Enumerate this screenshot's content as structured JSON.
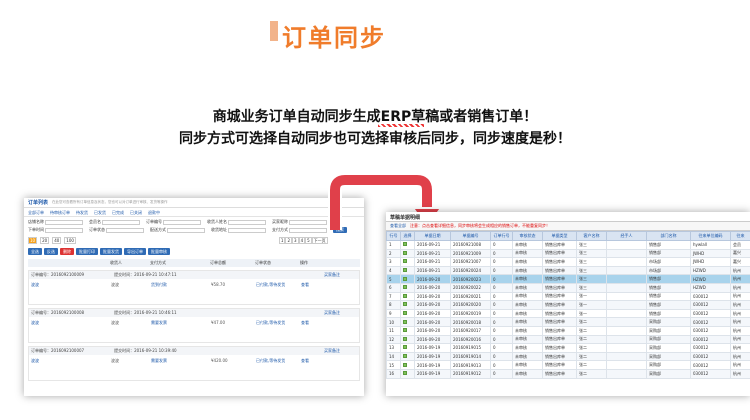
{
  "slide": {
    "title": "订单同步",
    "headline1": "商城业务订单自动同步生成ERP草稿或者销售订单！",
    "headline2": "同步方式可选择自动同步也可选择审核后同步，同步速度是秒！"
  },
  "colors": {
    "title": "#f07c2b",
    "arrow": "#e0404a",
    "grid_header": "#d9e4f2",
    "selected_row": "#a8d3ec"
  },
  "left_panel": {
    "title": "订单列表",
    "subtitle": "在此您可查看所有订单信息及状态，您也可以对订单进行审核、发货等操作",
    "tabs": [
      "全部订单",
      "待审核订单",
      "待发货",
      "已发货",
      "已完成",
      "已关闭",
      "退款中"
    ],
    "filters": [
      "店铺名称",
      "会员名",
      "订单编号",
      "收货人姓名",
      "买家昵称",
      "下单时间",
      "订单状态",
      "配送方式",
      "收货地址",
      "支付方式"
    ],
    "search_label": "搜索",
    "pager": [
      "10",
      "20",
      "40",
      "100"
    ],
    "pager_nav": [
      "1",
      "2",
      "3",
      "4",
      "5",
      "下一页"
    ],
    "actions": [
      "全选",
      "反选",
      "删除",
      "批量打印",
      "批量发货",
      "导出订单",
      "批量审核"
    ],
    "columns": [
      "收货人",
      "支付方式",
      "订单总额",
      "订单状态",
      "操作"
    ],
    "orders": [
      {
        "no": "订单编号：2016092100009",
        "time": "提交时间：2016-09-21 10:47:11",
        "buyer": "波波",
        "pay": "货到付款",
        "amount": "¥58.70",
        "status": "已付款,等待发货",
        "link": "查看",
        "shop": "买家备注"
      },
      {
        "no": "订单编号：2016092100008",
        "time": "提交时间：2016-09-21 10:46:11",
        "buyer": "波波",
        "pay": "需要发票",
        "amount": "¥47.00",
        "status": "已付款,等待发货",
        "link": "查看",
        "shop": "买家备注"
      },
      {
        "no": "订单编号：2016092100007",
        "time": "提交时间：2016-09-21 10:39:40",
        "buyer": "波波",
        "pay": "需要发票",
        "amount": "¥420.00",
        "status": "已付款,等待发货",
        "link": "查看",
        "shop": "买家备注"
      }
    ]
  },
  "right_panel": {
    "title": "草稿单据明细",
    "toolbar": [
      "查看全部",
      "注意：点击查看详细信息，同步审核将会生成相应的销售订单，不能重复同步！"
    ],
    "columns": [
      "行号",
      "选择",
      "单据日期",
      "单据编号",
      "订单行号",
      "审核状态",
      "单据类型",
      "客户名称",
      "经手人",
      "部门名称",
      "往来单位编码",
      "往来"
    ],
    "rows": [
      [
        "1",
        "2016-09-21",
        "20160921008",
        "0",
        "未审核",
        "销售出库单",
        "张三",
        "销售部",
        "hywlall",
        "会员"
      ],
      [
        "2",
        "2016-09-21",
        "20160921009",
        "0",
        "未审核",
        "销售出库单",
        "张三",
        "销售部",
        "JWHD",
        "嘉兴"
      ],
      [
        "3",
        "2016-09-21",
        "20160921007",
        "0",
        "未审核",
        "销售出库单",
        "张三",
        "市场部",
        "JWHD",
        "嘉兴"
      ],
      [
        "4",
        "2016-09-21",
        "20160920024",
        "0",
        "未审核",
        "销售出库单",
        "张三",
        "市场部",
        "HZWD",
        "杭州"
      ],
      [
        "5",
        "2016-09-20",
        "20160920023",
        "0",
        "未审核",
        "销售出库单",
        "张三",
        "销售部",
        "HZWD",
        "杭州"
      ],
      [
        "6",
        "2016-09-20",
        "20160920022",
        "0",
        "未审核",
        "销售出库单",
        "张三",
        "销售部",
        "HZWD",
        "杭州"
      ],
      [
        "7",
        "2016-09-20",
        "20160920021",
        "0",
        "未审核",
        "销售出库单",
        "张一",
        "销售部",
        "030012",
        "杭州"
      ],
      [
        "8",
        "2016-09-20",
        "20160920020",
        "0",
        "未审核",
        "销售出库单",
        "张一",
        "销售部",
        "030012",
        "杭州"
      ],
      [
        "9",
        "2016-09-20",
        "20160920019",
        "0",
        "未审核",
        "销售出库单",
        "张一",
        "销售部",
        "030012",
        "杭州"
      ],
      [
        "10",
        "2016-09-20",
        "20160920018",
        "0",
        "未审核",
        "销售出库单",
        "张二",
        "采购部",
        "030012",
        "杭州"
      ],
      [
        "11",
        "2016-09-20",
        "20160920017",
        "0",
        "未审核",
        "销售出库单",
        "张二",
        "采购部",
        "030012",
        "杭州"
      ],
      [
        "12",
        "2016-09-20",
        "20160920016",
        "0",
        "未审核",
        "销售出库单",
        "张二",
        "采购部",
        "030012",
        "杭州"
      ],
      [
        "13",
        "2016-09-19",
        "20160919015",
        "0",
        "未审核",
        "销售出库单",
        "张二",
        "采购部",
        "030012",
        "杭州"
      ],
      [
        "14",
        "2016-09-19",
        "20160919014",
        "0",
        "未审核",
        "销售出库单",
        "张二",
        "采购部",
        "030012",
        "杭州"
      ],
      [
        "15",
        "2016-09-19",
        "20160919013",
        "0",
        "未审核",
        "销售出库单",
        "张二",
        "采购部",
        "030012",
        "杭州"
      ],
      [
        "16",
        "2016-09-19",
        "20160919012",
        "0",
        "未审核",
        "销售出库单",
        "张二",
        "采购部",
        "030012",
        "杭州"
      ]
    ],
    "selected_row": "5"
  }
}
